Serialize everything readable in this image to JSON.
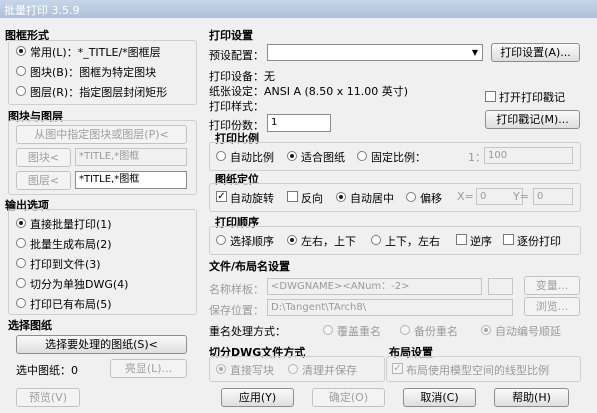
{
  "window": {
    "title": "批量打印 3.5.9"
  },
  "left": {
    "graphic_mode": {
      "title": "图框形式",
      "options": [
        {
          "label": "常用(L)：*_TITLE/*图框层",
          "checked": true
        },
        {
          "label": "图块(B)：图框为特定图块",
          "checked": false
        },
        {
          "label": "图层(R)：指定图层封闭矩形",
          "checked": false
        }
      ]
    },
    "block_layer": {
      "title": "图块与图层",
      "pick_button": "从图中指定图块或图层(P)<",
      "block_button": "图块<",
      "block_value": "*TITLE,*图框",
      "layer_button": "图层<",
      "layer_value": "*TITLE,*图框"
    },
    "output": {
      "title": "输出选项",
      "options": [
        {
          "label": "直接批量打印(1)",
          "checked": true
        },
        {
          "label": "批量生成布局(2)",
          "checked": false
        },
        {
          "label": "打印到文件(3)",
          "checked": false
        },
        {
          "label": "切分为单独DWG(4)",
          "checked": false
        },
        {
          "label": "打印已有布局(5)",
          "checked": false
        }
      ]
    },
    "select": {
      "title": "选择图纸",
      "button": "选择要处理的图纸(S)<",
      "selected_label": "选中图纸：0",
      "highlight_button": "亮显(L)..."
    }
  },
  "right": {
    "print_settings": {
      "title": "打印设置",
      "preset_label": "预设配置：",
      "preset_value": "",
      "settings_button": "打印设置(A)...",
      "device": "打印设备：无",
      "paper": "纸张设定：ANSI A (8.50 x 11.00 英寸)",
      "style": "打印样式：",
      "copies_label": "打印份数：",
      "copies_value": "1",
      "open_stamp_label": "打开打印戳记",
      "stamp_button": "打印戳记(M)..."
    },
    "scale": {
      "title": "打印比例",
      "options": [
        "自动比例",
        "适合图纸",
        "固定比例："
      ],
      "selected": 1,
      "colon": "1：",
      "value": "100"
    },
    "position": {
      "title": "图纸定位",
      "auto_rotate": "自动旋转",
      "reverse": "反向",
      "center": "自动居中",
      "offset": "偏移",
      "x_label": "X=",
      "x_value": "0",
      "y_label": "Y=",
      "y_value": "0"
    },
    "order": {
      "title": "打印顺序",
      "options": [
        "选择顺序",
        "左右，上下",
        "上下，左右"
      ],
      "selected": 1,
      "reverse": "逆序",
      "page_print": "逐份打印"
    },
    "file": {
      "title": "文件/布局名设置",
      "name_label": "名称样板：",
      "name_value": "<DWGNAME><ANum：-2>",
      "change_button": "变量...",
      "save_label": "保存位置：",
      "save_value": "D:\\Tangent\\TArch8\\",
      "browse_button": "浏览...",
      "rename_label": "重名处理方式：",
      "rename_options": [
        "覆盖重名",
        "备份重名",
        "自动编号顺延"
      ],
      "rename_selected": 2
    },
    "split": {
      "title": "切分DWG文件方式",
      "options": [
        "直接写块",
        "清理并保存"
      ],
      "selected": 0
    },
    "layout": {
      "title": "布局设置",
      "option": "布局使用模型空间的线型比例",
      "checked": true
    }
  },
  "footer": {
    "preview": "预览(V)",
    "apply": "应用(Y)",
    "ok": "确定(O)",
    "cancel": "取消(C)",
    "help": "帮助(H)"
  }
}
